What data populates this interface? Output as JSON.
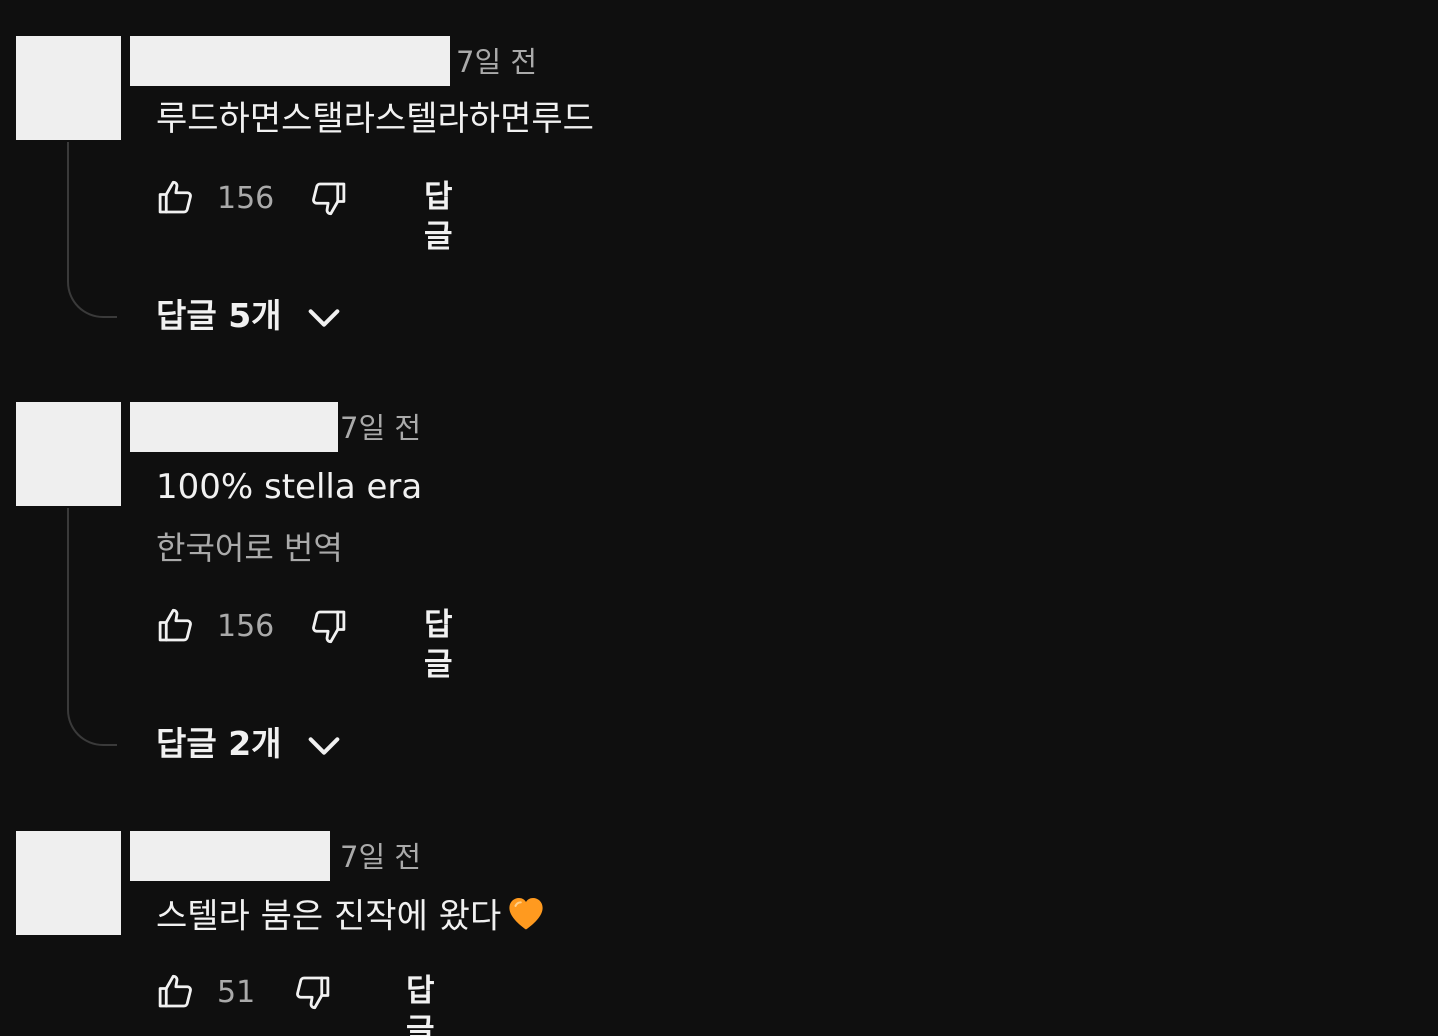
{
  "comments": [
    {
      "time": "7일 전",
      "text": "루드하면스탤라스텔라하면루드",
      "likes": "156",
      "reply_label": "답글",
      "replies_label": "답글 5개"
    },
    {
      "time": "7일 전",
      "text": "100% stella era",
      "translate": "한국어로 번역",
      "likes": "156",
      "reply_label": "답글",
      "replies_label": "답글 2개"
    },
    {
      "time": "7일 전",
      "text": "스텔라 붐은 진작에 왔다",
      "emoji": "orange-heart",
      "likes": "51",
      "reply_label": "답글"
    }
  ],
  "colors": {
    "background": "#0f0f0f",
    "text_primary": "#f1f1f1",
    "text_secondary": "#aaaaaa",
    "placeholder": "#efefef",
    "heart": "#ff9a1f"
  },
  "icons": [
    "like-icon",
    "dislike-icon",
    "chevron-down-icon",
    "orange-heart-icon"
  ]
}
